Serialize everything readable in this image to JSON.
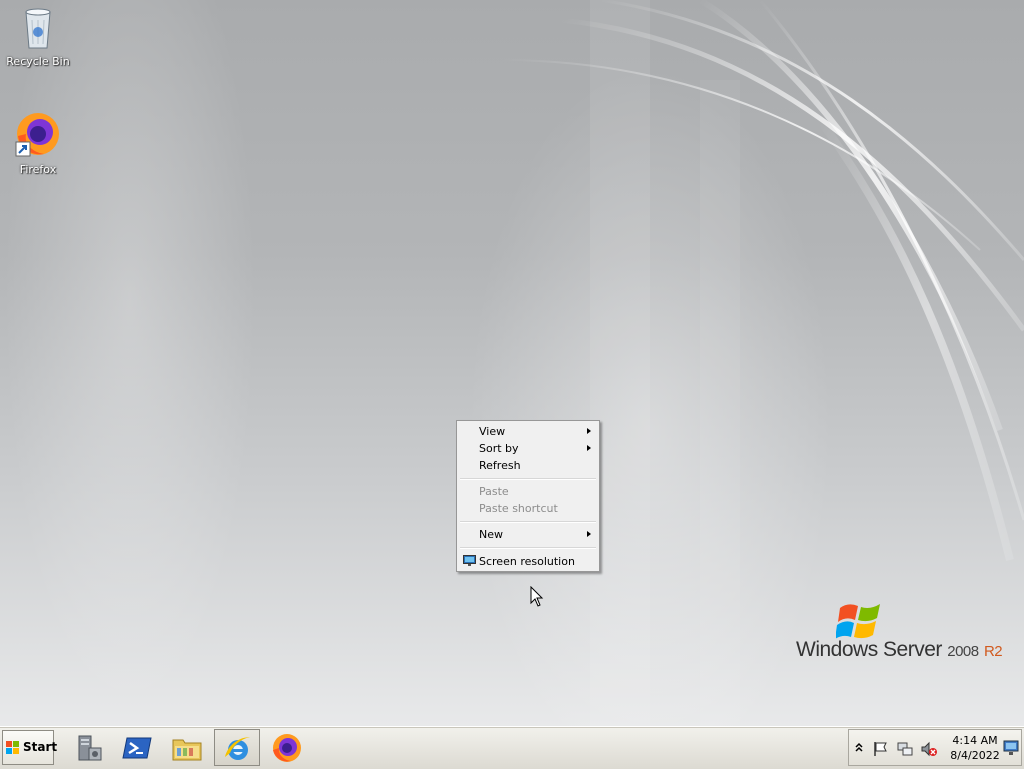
{
  "desktop": {
    "icons": [
      {
        "name": "recycle-bin",
        "label": "Recycle Bin"
      },
      {
        "name": "firefox",
        "label": "Firefox"
      }
    ],
    "branding": {
      "product": "Windows Server",
      "version": "2008",
      "edition": "R2"
    }
  },
  "context_menu": {
    "items": [
      {
        "label": "View",
        "submenu": true,
        "enabled": true
      },
      {
        "label": "Sort by",
        "submenu": true,
        "enabled": true
      },
      {
        "label": "Refresh",
        "submenu": false,
        "enabled": true
      },
      {
        "label": "Paste",
        "submenu": false,
        "enabled": false
      },
      {
        "label": "Paste shortcut",
        "submenu": false,
        "enabled": false
      },
      {
        "label": "New",
        "submenu": true,
        "enabled": true
      },
      {
        "label": "Screen resolution",
        "submenu": false,
        "enabled": true,
        "icon": "monitor-icon"
      }
    ]
  },
  "taskbar": {
    "start_label": "Start",
    "pinned": [
      {
        "name": "server-manager",
        "icon": "server-manager-icon"
      },
      {
        "name": "powershell",
        "icon": "powershell-icon"
      },
      {
        "name": "windows-explorer",
        "icon": "folder-icon"
      },
      {
        "name": "internet-explorer",
        "icon": "ie-icon",
        "active": true
      },
      {
        "name": "firefox",
        "icon": "firefox-icon"
      }
    ],
    "tray": {
      "icons": [
        "show-hidden-icons-icon",
        "action-center-flag-icon",
        "network-icon",
        "volume-muted-icon"
      ],
      "time": "4:14 AM",
      "date": "8/4/2022"
    }
  },
  "colors": {
    "accent_r2": "#d15a1f",
    "menu_bg": "#f0f0f0",
    "taskbar_bg": "#dcdad2"
  }
}
